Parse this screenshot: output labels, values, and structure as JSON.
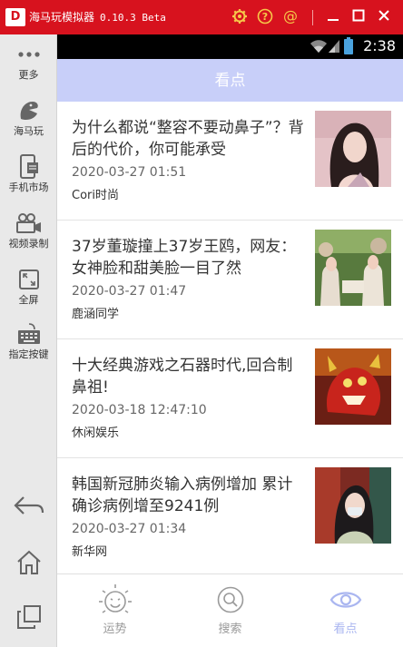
{
  "window": {
    "app_name": "海马玩模拟器",
    "version": "0.10.3 Beta",
    "icons": [
      "settings-icon",
      "help-icon",
      "at-icon",
      "minimize-icon",
      "maximize-icon",
      "close-icon"
    ],
    "accent": "#d7121e"
  },
  "sidebar": {
    "items": [
      {
        "label": "更多",
        "icon": "more-dots-icon"
      },
      {
        "label": "海马玩",
        "icon": "haima-logo-icon"
      },
      {
        "label": "手机市场",
        "icon": "phone-market-icon"
      },
      {
        "label": "视频录制",
        "icon": "video-record-icon"
      },
      {
        "label": "全屏",
        "icon": "fullscreen-icon"
      },
      {
        "label": "指定按键",
        "icon": "keyboard-icon"
      }
    ],
    "nav": [
      "back-icon",
      "home-icon",
      "recent-apps-icon"
    ]
  },
  "statusbar": {
    "time": "2:38",
    "icons": [
      "wifi-icon",
      "signal-icon",
      "battery-icon"
    ]
  },
  "header": {
    "title": "看点",
    "color": "#c8cff9"
  },
  "feed": {
    "items": [
      {
        "title": "为什么都说“整容不要动鼻子”？背后的代价，你可能承受",
        "date": "2020-03-27 01:51",
        "source": "Cori时尚"
      },
      {
        "title": "37岁董璇撞上37岁王鸥，网友：女神脸和甜美脸一目了然",
        "date": "2020-03-27 01:47",
        "source": "鹿涵同学"
      },
      {
        "title": "十大经典游戏之石器时代,回合制鼻祖!",
        "date": "2020-03-18 12:47:10",
        "source": "休闲娱乐"
      },
      {
        "title": "韩国新冠肺炎输入病例增加 累计确诊病例增至9241例",
        "date": "2020-03-27 01:34",
        "source": "新华网"
      }
    ]
  },
  "bottom_nav": {
    "items": [
      {
        "label": "运势",
        "icon": "sun-face-icon"
      },
      {
        "label": "搜索",
        "icon": "search-icon"
      },
      {
        "label": "看点",
        "icon": "eye-icon",
        "active": true
      }
    ],
    "active_color": "#aab6f0"
  }
}
